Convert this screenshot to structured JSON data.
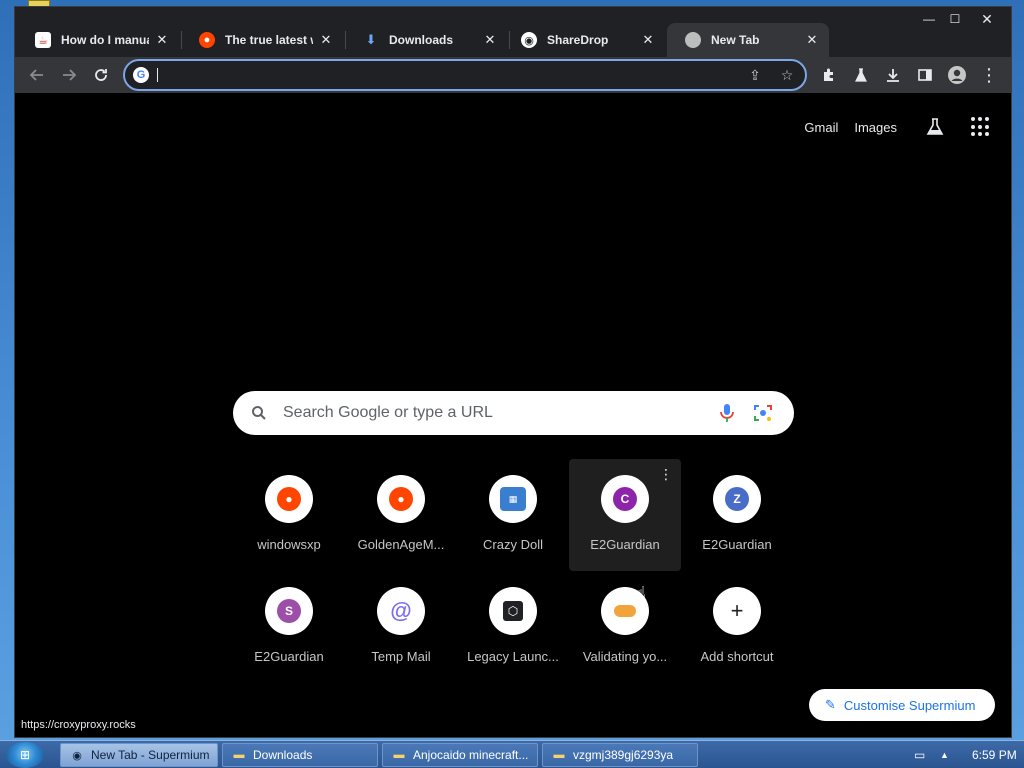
{
  "tabs": [
    {
      "title": "How do I manuall",
      "favicon": "java-icon"
    },
    {
      "title": "The true latest wo",
      "favicon": "reddit-icon"
    },
    {
      "title": "Downloads",
      "favicon": "download-icon"
    },
    {
      "title": "ShareDrop",
      "favicon": "sharedrop-icon"
    },
    {
      "title": "New Tab",
      "favicon": "globe-icon",
      "active": true
    }
  ],
  "window_controls": {
    "minimize": "—",
    "maximize": "☐",
    "close": "✕"
  },
  "omnibox": {
    "value": "",
    "placeholder": ""
  },
  "top_links": {
    "gmail": "Gmail",
    "images": "Images"
  },
  "search": {
    "placeholder": "Search Google or type a URL"
  },
  "shortcuts": [
    {
      "label": "windowsxp",
      "icon": "reddit-icon",
      "color": "#ff4500"
    },
    {
      "label": "GoldenAgeM...",
      "icon": "reddit-icon",
      "color": "#ff4500"
    },
    {
      "label": "Crazy Doll",
      "icon": "bitview-icon",
      "color": "#3a7fcf"
    },
    {
      "label": "E2Guardian",
      "icon": "letter-c-icon",
      "letter": "C",
      "color": "#8e24aa"
    },
    {
      "label": "E2Guardian",
      "icon": "letter-z-icon",
      "letter": "Z",
      "color": "#4a6cc9"
    },
    {
      "label": "E2Guardian",
      "icon": "letter-s-icon",
      "letter": "S",
      "color": "#9c4ea8"
    },
    {
      "label": "Temp Mail",
      "icon": "at-icon",
      "color": "#7b6cf6"
    },
    {
      "label": "Legacy Launc...",
      "icon": "cube-icon",
      "color": "#202124"
    },
    {
      "label": "Validating yo...",
      "icon": "candy-icon",
      "color": "#f2a33a"
    },
    {
      "label": "Add shortcut",
      "icon": "plus-icon",
      "color": "#202124"
    }
  ],
  "customise_label": "Customise Supermium",
  "status_url": "https://croxyproxy.rocks",
  "taskbar": {
    "tasks": [
      {
        "label": "New Tab - Supermium",
        "icon": "supermium-icon",
        "active": true
      },
      {
        "label": "Downloads",
        "icon": "folder-icon"
      },
      {
        "label": "Anjocaido minecraft...",
        "icon": "folder-icon"
      },
      {
        "label": "vzgmj389gj6293ya",
        "icon": "folder-icon"
      }
    ],
    "clock": "6:59 PM"
  },
  "colors": {
    "accent": "#7ba7e6",
    "link": "#1a73e8",
    "reddit": "#ff4500"
  }
}
